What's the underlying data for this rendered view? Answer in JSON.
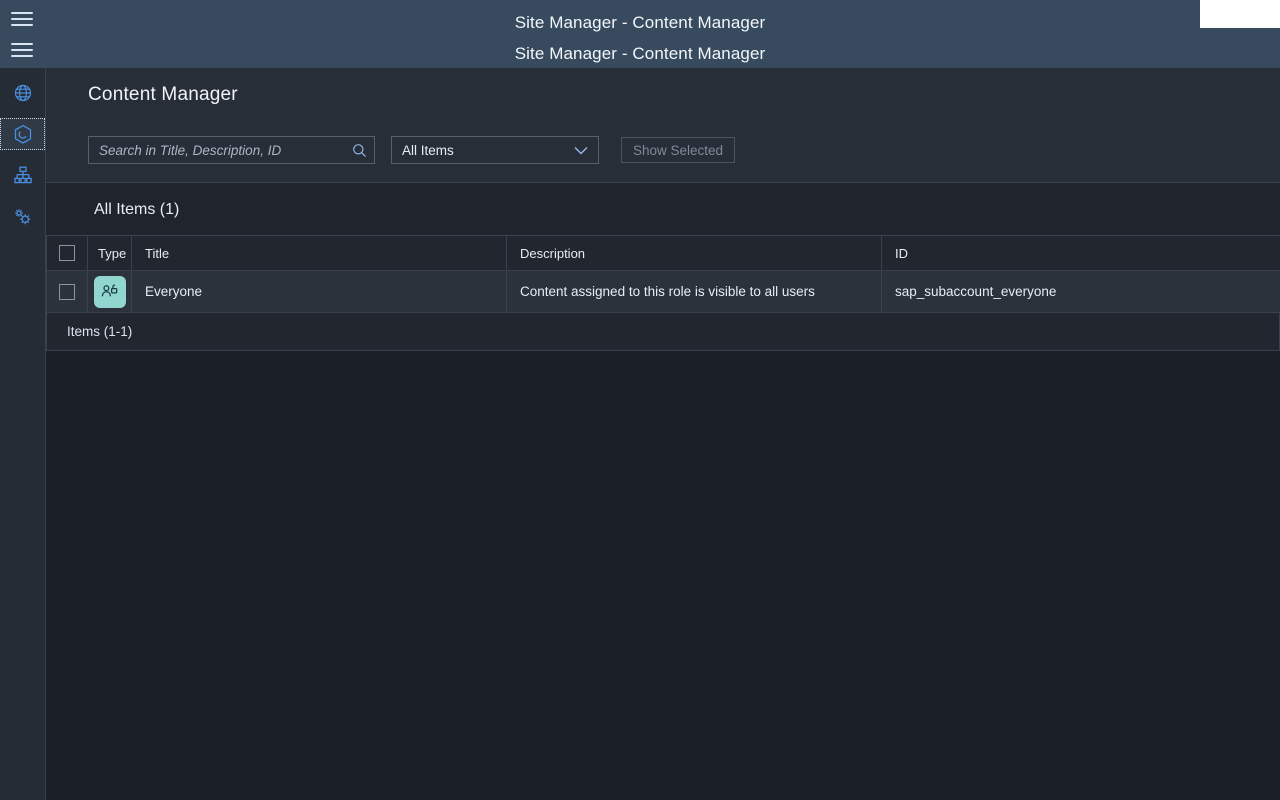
{
  "window": {
    "title_primary": "Site Manager - Content Manager",
    "title_secondary": "Site Manager - Content Manager"
  },
  "colors": {
    "header_bg": "#374a5e",
    "rail_bg": "#262c36",
    "content_bg": "#1b1f27",
    "toolbar_bg": "#282e38",
    "table_header_bg": "#22262f",
    "table_row_bg": "#2c323c",
    "accent_icon": "#4a90e2",
    "type_badge_bg": "#92d7cf",
    "disabled_text": "#7e8a99"
  },
  "topbar": {
    "menu_toggle_label": "menu",
    "secondary_menu_toggle_label": "menu"
  },
  "rail": {
    "items": [
      {
        "id": "globe",
        "icon": "globe-icon",
        "label": "Site Directory",
        "selected": false
      },
      {
        "id": "content",
        "icon": "cube-icon",
        "label": "Content Manager",
        "selected": true
      },
      {
        "id": "structure",
        "icon": "hierarchy-icon",
        "label": "Site Structure",
        "selected": false
      },
      {
        "id": "settings",
        "icon": "gears-icon",
        "label": "Settings",
        "selected": false
      }
    ]
  },
  "page": {
    "title": "Content Manager"
  },
  "toolbar": {
    "search_placeholder": "Search in Title, Description, ID",
    "search_value": "",
    "search_icon": "search-icon",
    "filter_selected": "All Items",
    "filter_options": [
      "All Items"
    ],
    "filter_caret_icon": "chevron-down-icon",
    "show_selected_label": "Show Selected",
    "show_selected_disabled": true
  },
  "table": {
    "section_title": "All Items (1)",
    "select_all_checked": false,
    "columns": [
      {
        "key": "check",
        "label": ""
      },
      {
        "key": "type",
        "label": "Type"
      },
      {
        "key": "title",
        "label": "Title"
      },
      {
        "key": "description",
        "label": "Description"
      },
      {
        "key": "id",
        "label": "ID"
      }
    ],
    "rows": [
      {
        "checked": false,
        "type_icon": "role-everyone-icon",
        "title": "Everyone",
        "description": "Content assigned to this role is visible to all users",
        "id": "sap_subaccount_everyone"
      }
    ],
    "footer": "Items (1-1)"
  }
}
